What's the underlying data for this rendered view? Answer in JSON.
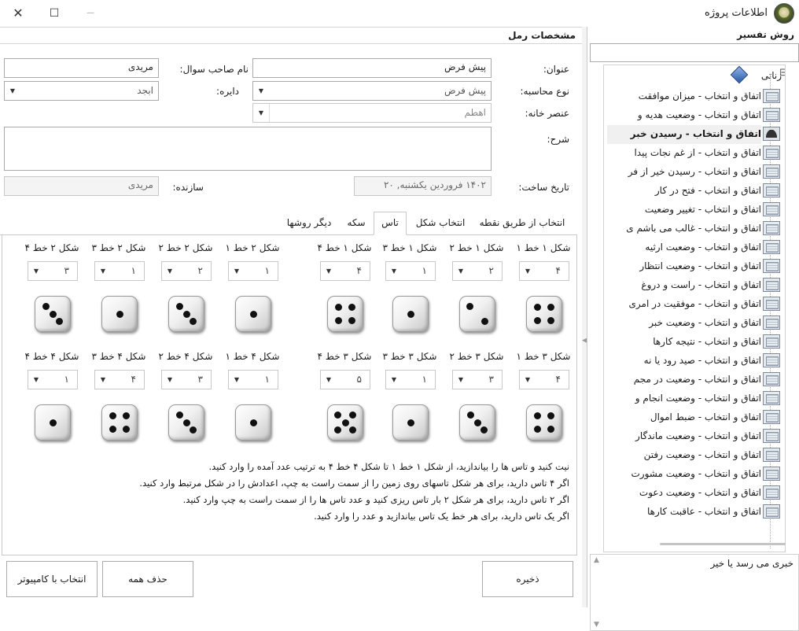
{
  "window": {
    "title": "اطلاعات پروژه",
    "minimize_glyph": "—",
    "maximize_glyph": "☐",
    "close_glyph": "✕"
  },
  "form": {
    "section_title": "مشخصات رمل",
    "title_label": "عنوان:",
    "title_value": "پیش فرض",
    "asker_label": "نام صاحب سوال:",
    "asker_value": "مریدی",
    "calc_type_label": "نوع محاسبه:",
    "calc_type_value": "پیش فرض",
    "circle_label": "دایره:",
    "circle_value": "ابجد",
    "house_element_label": "عنصر خانه:",
    "house_element_value": "اهطم",
    "description_label": "شرح:",
    "description_value": "",
    "created_label": "تاریخ ساخت:",
    "created_value": "۱۴۰۲ فروردین یکشنبه, ۲۰",
    "creator_label": "سازنده:",
    "creator_value": "مریدی"
  },
  "tabs": [
    {
      "label": "انتخاب از طریق نقطه"
    },
    {
      "label": "انتخاب شکل"
    },
    {
      "label": "تاس"
    },
    {
      "label": "سکه"
    },
    {
      "label": "دیگر روشها"
    }
  ],
  "dice": [
    {
      "label": "شکل ۱ خط ۱",
      "value": "۴",
      "pips": 4
    },
    {
      "label": "شکل ۱ خط ۲",
      "value": "۲",
      "pips": 2
    },
    {
      "label": "شکل ۱ خط ۳",
      "value": "۱",
      "pips": 1
    },
    {
      "label": "شکل ۱ خط ۴",
      "value": "۴",
      "pips": 4
    },
    {
      "label": "شکل ۲ خط ۱",
      "value": "۱",
      "pips": 1
    },
    {
      "label": "شکل ۲ خط ۲",
      "value": "۲",
      "pips": 3
    },
    {
      "label": "شکل ۲ خط ۳",
      "value": "۱",
      "pips": 1
    },
    {
      "label": "شکل ۲ خط ۴",
      "value": "۳",
      "pips": 3
    },
    {
      "label": "شکل ۳ خط ۱",
      "value": "۴",
      "pips": 4
    },
    {
      "label": "شکل ۳ خط ۲",
      "value": "۳",
      "pips": 3
    },
    {
      "label": "شکل ۳ خط ۳",
      "value": "۱",
      "pips": 1
    },
    {
      "label": "شکل ۳ خط ۴",
      "value": "۵",
      "pips": 5
    },
    {
      "label": "شکل ۴ خط ۱",
      "value": "۱",
      "pips": 1
    },
    {
      "label": "شکل ۴ خط ۲",
      "value": "۳",
      "pips": 3
    },
    {
      "label": "شکل ۴ خط ۳",
      "value": "۴",
      "pips": 4
    },
    {
      "label": "شکل ۴ خط ۴",
      "value": "۱",
      "pips": 1
    }
  ],
  "instructions": [
    "نیت کنید و تاس ها را بیاندازید، از شکل ۱ خط ۱ تا شکل ۴ خط ۴ به ترتیب عدد آمده را وارد کنید.",
    "اگر ۴ تاس دارید، برای هر شکل تاسهای روی زمین را از سمت راست به چپ، اعدادش را در شکل مرتبط وارد کنید.",
    "اگر ۲ تاس دارید، برای هر شکل ۲ بار تاس ریزی کنید و عدد تاس ها را از سمت راست به چپ وارد کنید.",
    "اگر یک تاس دارید، برای هر خط یک تاس بیاندازید و عدد را وارد کنید."
  ],
  "buttons": {
    "save": "ذخیره",
    "delete_all": "حذف همه",
    "computer_pick": "انتخاب با کامپیوتر"
  },
  "sidebar": {
    "title": "روش تفسیر",
    "search_value": "",
    "root_label": "زناتی",
    "collapse_glyph": "⊟",
    "items": [
      {
        "label": "اتفاق و انتخاب - میزان موافقت",
        "icon": "document-icon"
      },
      {
        "label": "اتفاق و انتخاب - وضعیت هدیه و",
        "icon": "document-icon"
      },
      {
        "label": "اتفاق و انتخاب - رسیدن خبر",
        "icon": "person-icon",
        "selected": true
      },
      {
        "label": "اتفاق و انتخاب - از غم نجات پیدا",
        "icon": "document-icon"
      },
      {
        "label": "اتفاق و انتخاب - رسیدن خیر از فر",
        "icon": "document-icon"
      },
      {
        "label": "اتفاق و انتخاب - فتح در کار",
        "icon": "document-icon"
      },
      {
        "label": "اتفاق و انتخاب - تغییر وضعیت",
        "icon": "document-icon"
      },
      {
        "label": "اتفاق و انتخاب - غالب می باشم ی",
        "icon": "document-icon"
      },
      {
        "label": "اتفاق و انتخاب - وضعیت ارثیه",
        "icon": "document-icon"
      },
      {
        "label": "اتفاق و انتخاب - وضعیت انتظار",
        "icon": "document-icon"
      },
      {
        "label": "اتفاق و انتخاب - راست و دروغ",
        "icon": "document-icon"
      },
      {
        "label": "اتفاق و انتخاب - موفقیت در امری",
        "icon": "document-icon"
      },
      {
        "label": "اتفاق و انتخاب - وضعیت خبر",
        "icon": "document-icon"
      },
      {
        "label": "اتفاق و انتخاب - نتیجه کارها",
        "icon": "document-icon"
      },
      {
        "label": "اتفاق و انتخاب - صید رود یا نه",
        "icon": "document-icon"
      },
      {
        "label": "اتفاق و انتخاب - وضعیت در مجم",
        "icon": "document-icon"
      },
      {
        "label": "اتفاق و انتخاب - وضعیت انجام و",
        "icon": "document-icon"
      },
      {
        "label": "اتفاق و انتخاب - ضبط اموال",
        "icon": "document-icon"
      },
      {
        "label": "اتفاق و انتخاب - وضعیت ماندگار",
        "icon": "document-icon"
      },
      {
        "label": "اتفاق و انتخاب - وضعیت رفتن",
        "icon": "document-icon"
      },
      {
        "label": "اتفاق و انتخاب - وضعیت مشورت",
        "icon": "document-icon"
      },
      {
        "label": "اتفاق و انتخاب - وضعیت دعوت",
        "icon": "document-icon"
      },
      {
        "label": "اتفاق و انتخاب - عاقبت کارها",
        "icon": "document-icon"
      }
    ],
    "detail_text": "خبری می رسد یا خیر"
  }
}
